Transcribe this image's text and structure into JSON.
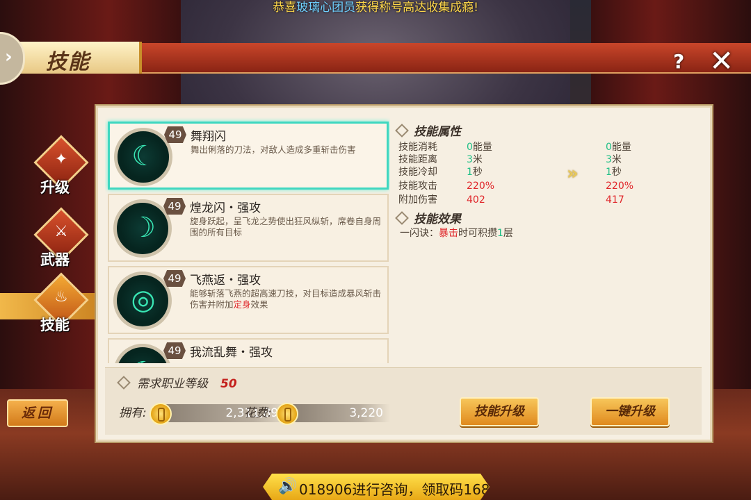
{
  "announcement": {
    "prefix": "恭喜",
    "name": "玻璃心团员",
    "suffix": "获得称号高达收集成瘾!"
  },
  "header": {
    "title": "技能",
    "back_glyph": "›",
    "help_label": "?",
    "close_label": "✕"
  },
  "sidebar": {
    "items": [
      {
        "label": "升级",
        "icon": "upgrade-icon"
      },
      {
        "label": "武器",
        "icon": "weapon-icon"
      },
      {
        "label": "技能",
        "icon": "skill-icon",
        "active": true
      }
    ],
    "return_label": "返回"
  },
  "skills": [
    {
      "level": "49",
      "name": "舞翔闪",
      "desc": "舞出俐落的刀法，对敌人造成多重斩击伤害",
      "selected": true
    },
    {
      "level": "49",
      "name": "煌龙闪・强攻",
      "desc": "旋身跃起，呈飞龙之势使出狂风纵斩，席卷自身周围的所有目标"
    },
    {
      "level": "49",
      "name": "飞燕返・强攻",
      "desc_a": "能够斩落飞燕的超高速刀技，对目标造成暴风斩击伤害并附加",
      "desc_red": "定身",
      "desc_b": "效果"
    },
    {
      "level": "49",
      "name": "我流乱舞・强攻",
      "desc": ""
    }
  ],
  "detail": {
    "attr_title": "技能属性",
    "rows": [
      {
        "label": "技能消耗",
        "cur_num": "0",
        "cur_unit": "能量",
        "next_num": "0",
        "next_unit": "能量"
      },
      {
        "label": "技能距离",
        "cur_num": "3",
        "cur_unit": "米",
        "next_num": "3",
        "next_unit": "米"
      },
      {
        "label": "技能冷却",
        "cur_num": "1",
        "cur_unit": "秒",
        "next_num": "1",
        "next_unit": "秒"
      },
      {
        "label": "技能攻击",
        "cur": "220%",
        "next": "220%"
      },
      {
        "label": "附加伤害",
        "cur": "402",
        "next": "417"
      }
    ],
    "arrow": "»",
    "effect_title": "技能效果",
    "effect": {
      "a": "一闪诀：",
      "red": "暴击",
      "b": "时可积攒",
      "green": "1",
      "c": "层"
    }
  },
  "bottom": {
    "req_label": "需求职业等级",
    "req_value": "50",
    "own_label": "拥有:",
    "own_amount": "2,311,896",
    "cost_label": "花费:",
    "cost_amount": "3,220",
    "upgrade_label": "技能升级",
    "upgrade_all_label": "一键升级"
  },
  "notice": {
    "icon": "speaker-icon",
    "text": "018906进行咨询，领取码168"
  },
  "colors": {
    "accent": "#3fd7c0",
    "gold": "#f7c65a",
    "red": "#e0262a",
    "green": "#1fbf86"
  }
}
